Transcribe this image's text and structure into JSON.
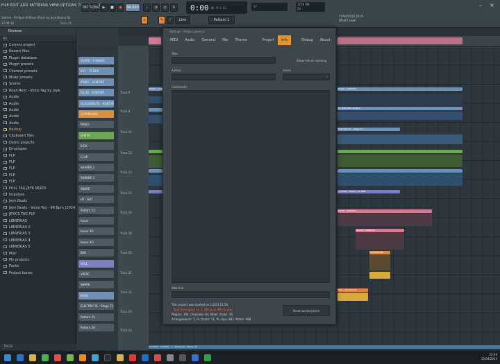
{
  "topbar": {
    "menu": "FILE  EDIT  ADD  PATTERNS  VIEW  OPTIONS  TOOLS  HELP",
    "song": "Vultree - 94 Bpm B Minor (Prod. by Jeyk Beats).flp",
    "time_pos": "22:04:14",
    "track_readout": "Track 24",
    "pat_label": "PAT",
    "song_label": "SONG",
    "tempo": "94.000",
    "clock": "0:00",
    "clock_ms": "00",
    "clock_unit": "M:S:CS",
    "cpu": "27",
    "memory": "1759 MB",
    "memory_sub": "24",
    "pattern_label": "Pattern 1",
    "line_label": "Line",
    "news_line1": "15/04/2024 22:21",
    "news_line2": "What's new?"
  },
  "browser": {
    "title": "Browser",
    "tools": "All",
    "items": [
      {
        "label": "Current project",
        "hl": false
      },
      {
        "label": "Recent files",
        "hl": false
      },
      {
        "label": "Plugin database",
        "hl": false
      },
      {
        "label": "Plugin presets",
        "hl": false
      },
      {
        "label": "Channel presets",
        "hl": false
      },
      {
        "label": "Mixer presets",
        "hl": false
      },
      {
        "label": "Scores",
        "hl": false
      },
      {
        "label": "Road Rem - Voice Tag by Jeyk",
        "hl": false
      },
      {
        "label": "Audio",
        "hl": false
      },
      {
        "label": "Audio",
        "hl": false
      },
      {
        "label": "Audio",
        "hl": false
      },
      {
        "label": "Audio",
        "hl": false
      },
      {
        "label": "Audio",
        "hl": false
      },
      {
        "label": "Backup",
        "hl": true
      },
      {
        "label": "Clipboard files",
        "hl": false
      },
      {
        "label": "Demo projects",
        "hl": false
      },
      {
        "label": "Envelopes",
        "hl": false
      },
      {
        "label": "FLP",
        "hl": false
      },
      {
        "label": "FLP",
        "hl": false
      },
      {
        "label": "FLP",
        "hl": false
      },
      {
        "label": "FLP",
        "hl": false
      },
      {
        "label": "FLP",
        "hl": false
      },
      {
        "label": "FULL TAG JEYK BEATS",
        "hl": false
      },
      {
        "label": "Impulses",
        "hl": false
      },
      {
        "label": "Jeyk Beats",
        "hl": false
      },
      {
        "label": "Jeyk Beats - Voice Tag - 98 Bpm (2024)",
        "hl": false
      },
      {
        "label": "JEYK'S TAG FLP",
        "hl": false
      },
      {
        "label": "LIBRERIAS",
        "hl": false
      },
      {
        "label": "LIBRERIAS 2",
        "hl": false
      },
      {
        "label": "LIBRERIAS 3",
        "hl": false
      },
      {
        "label": "LIBRERIAS 4",
        "hl": false
      },
      {
        "label": "LIBRERIAS 5",
        "hl": false
      },
      {
        "label": "Misc",
        "hl": false
      },
      {
        "label": "My projects",
        "hl": false
      },
      {
        "label": "Packs",
        "hl": false
      },
      {
        "label": "Project bones",
        "hl": false
      }
    ],
    "footer": "TAGS"
  },
  "rack": {
    "channels": [
      {
        "label": "SCARE - A MINOR",
        "color": "#6f8fb5"
      },
      {
        "label": "KEY - 75 BUP",
        "color": "#6f8fb5"
      },
      {
        "label": "PIANO - KONTAKT",
        "color": "#6f8fb5"
      },
      {
        "label": "FLUTE - KONTAKT",
        "color": "#6f8fb5"
      },
      {
        "label": "GLOCKENSITE - KONTAKT",
        "color": "#6f8fb5"
      },
      {
        "label": "SAXOPHONE",
        "color": "#d88f40"
      },
      {
        "label": "PIANO",
        "color": "#4f5b63"
      },
      {
        "label": "SYNTH",
        "color": "#6da455"
      },
      {
        "label": "KICK",
        "color": "#4f5b63"
      },
      {
        "label": "CLAP",
        "color": "#4f5b63"
      },
      {
        "label": "SHAKER 2",
        "color": "#4f5b63"
      },
      {
        "label": "SHAKER 3",
        "color": "#4f5b63"
      },
      {
        "label": "SNARE",
        "color": "#4f5b63"
      },
      {
        "label": "HT - HAT",
        "color": "#4f5b63"
      },
      {
        "label": "Pattern 15",
        "color": "#4f5b63"
      },
      {
        "label": "hover",
        "color": "#4f5b63"
      },
      {
        "label": "hover #2",
        "color": "#4f5b63"
      },
      {
        "label": "hover #3",
        "color": "#4f5b63"
      },
      {
        "label": "808",
        "color": "#4f5b63"
      },
      {
        "label": "ROLL",
        "color": "#7a7fc4"
      },
      {
        "label": "VPERC",
        "color": "#4f5b63"
      },
      {
        "label": "SNARE",
        "color": "#4f5b63"
      },
      {
        "label": "BASS",
        "color": "#6f8fb5"
      },
      {
        "label": "ELECTRIC PL - Stage 73",
        "color": "#4f5b63"
      },
      {
        "label": "Pattern 25",
        "color": "#4f5b63"
      },
      {
        "label": "Pattern 26",
        "color": "#4f5b63"
      }
    ]
  },
  "playlist": {
    "lanes": [
      "Track 6",
      "Track 8",
      "Track 10",
      "Track 12",
      "Track 13",
      "Track 15",
      "Track 16",
      "Track 18",
      "Track 20",
      "Track 21",
      "Track 22",
      "Track 23",
      "Track 24"
    ],
    "clip_labels": {
      "piano_left": "PIANO - KONTAKT",
      "piano_right": "PIANO - KONTAKT",
      "epiano": "EP (ELECTRIC PIANO)",
      "electric": "ELECTRIC PL - Stage 73",
      "cymbal": "Cymbals - Sweet - 94 BPM",
      "flute": "FLUTE - KONTAKT",
      "glock": "GLOCK - KONTAKT",
      "saxo": "SAXOPHONE",
      "vox": "VOX - Vox Sample",
      "bottom": "Cymbals - Cheetah - 3 - Ambience - Tempo 94"
    }
  },
  "dialog": {
    "window_title": "Settings - Project general",
    "tabs": [
      {
        "label": "MIDI",
        "active": false
      },
      {
        "label": "Audio",
        "active": false
      },
      {
        "label": "General",
        "active": false
      },
      {
        "label": "File",
        "active": false
      },
      {
        "label": "Theme",
        "active": false
      },
      {
        "label": "Project",
        "active": false
      },
      {
        "label": "Info",
        "active": true
      },
      {
        "label": "Debug",
        "active": false
      },
      {
        "label": "About",
        "active": false
      }
    ],
    "title_label": "Title",
    "show_info": "Show info on opening",
    "author_label": "Author",
    "genre_label": "Genre",
    "comments_label": "Comments",
    "weblink_label": "Web link",
    "info_started": "This project was started on 1/2/23 11:56",
    "info_time": "Total time spent on it: 28 hours 49 minutes",
    "info_plugins": "Plugins: 104, Channels: 44, Mixer tracks: 36",
    "info_arrangements": "Arrangements: 2, PL tracks: 51, PL clips: 402, Notes: 988",
    "reset_button": "Reset working time"
  },
  "taskbar": {
    "time": "22:04",
    "date": "15/04/2024"
  },
  "colors": {
    "accent": "#e49433",
    "clip_blue": "#6f8fb5",
    "clip_pink": "#d27a93",
    "clip_green": "#6da455"
  }
}
